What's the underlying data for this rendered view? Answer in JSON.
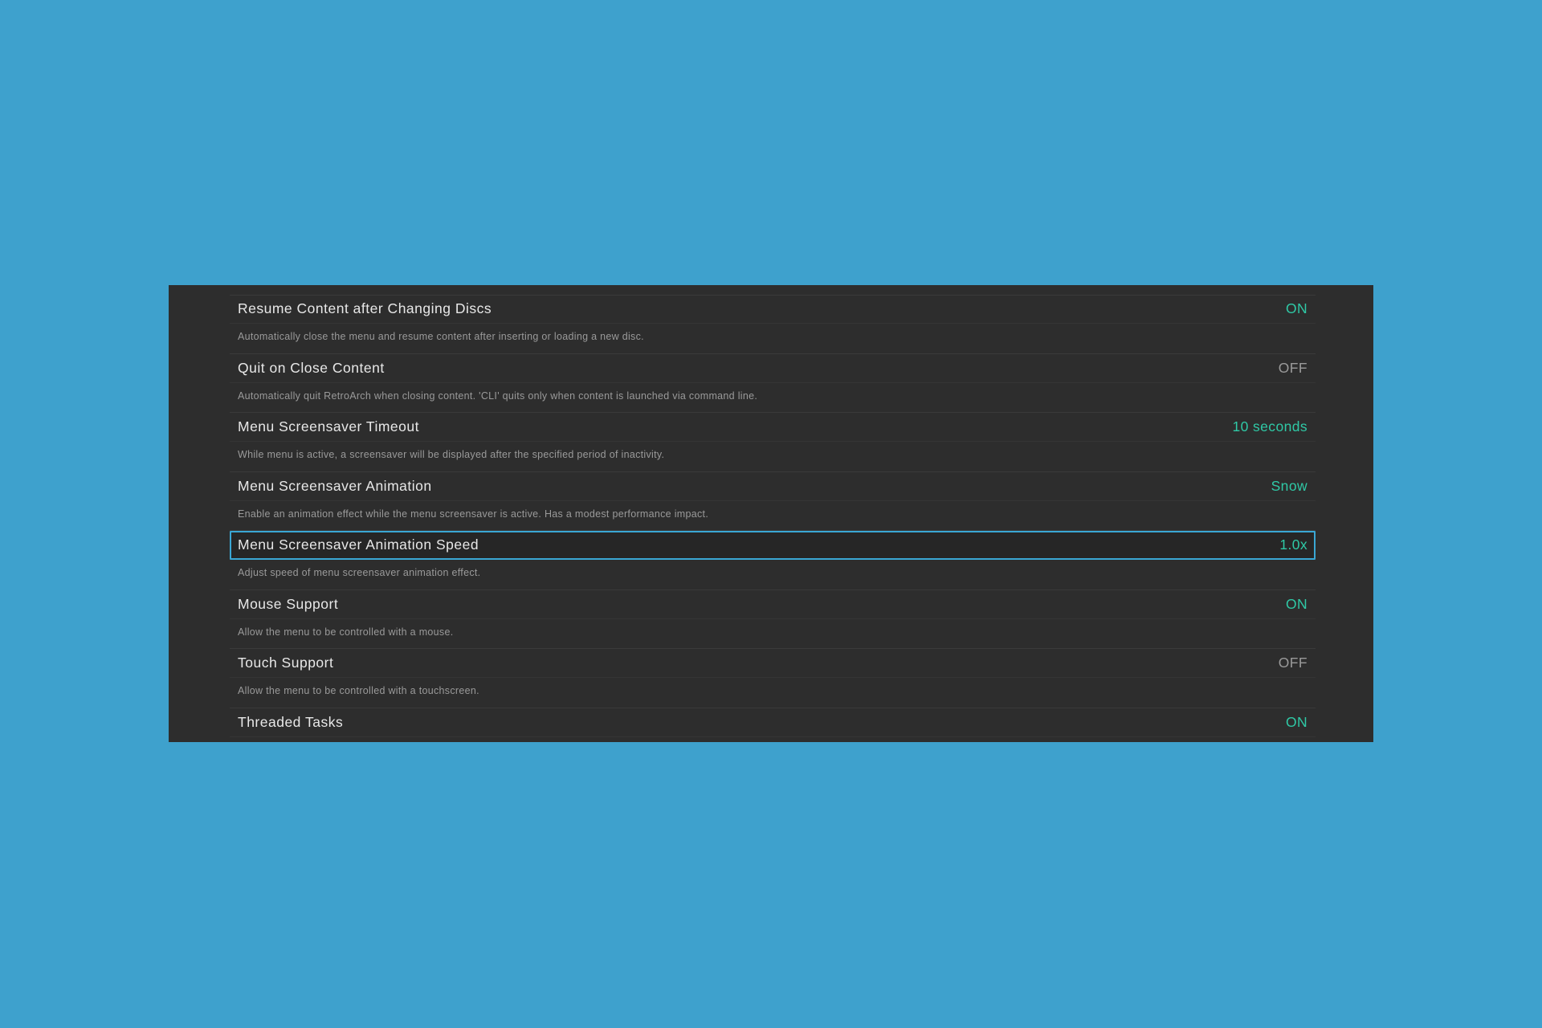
{
  "settings": {
    "items": [
      {
        "label": "Resume Content after Changing Discs",
        "value": "ON",
        "state": "on",
        "description": "Automatically close the menu and resume content after inserting or loading a new disc."
      },
      {
        "label": "Quit on Close Content",
        "value": "OFF",
        "state": "off",
        "description": "Automatically quit RetroArch when closing content. 'CLI' quits only when content is launched via command line."
      },
      {
        "label": "Menu Screensaver Timeout",
        "value": "10 seconds",
        "state": "value",
        "description": "While menu is active, a screensaver will be displayed after the specified period of inactivity."
      },
      {
        "label": "Menu Screensaver Animation",
        "value": "Snow",
        "state": "value",
        "description": "Enable an animation effect while the menu screensaver is active. Has a modest performance impact."
      },
      {
        "label": "Menu Screensaver Animation Speed",
        "value": "1.0x",
        "state": "value",
        "selected": true,
        "description": "Adjust speed of menu screensaver animation effect."
      },
      {
        "label": "Mouse Support",
        "value": "ON",
        "state": "on",
        "description": "Allow the menu to be controlled with a mouse."
      },
      {
        "label": "Touch Support",
        "value": "OFF",
        "state": "off",
        "description": "Allow the menu to be controlled with a touchscreen."
      },
      {
        "label": "Threaded Tasks",
        "value": "ON",
        "state": "on",
        "description": ""
      }
    ]
  },
  "colors": {
    "background": "#3ea1cd",
    "panel": "#2d2d2d",
    "on_value": "#2fc9a6",
    "off_value": "#9a9a9a",
    "selection_border": "#3aa7d4"
  }
}
